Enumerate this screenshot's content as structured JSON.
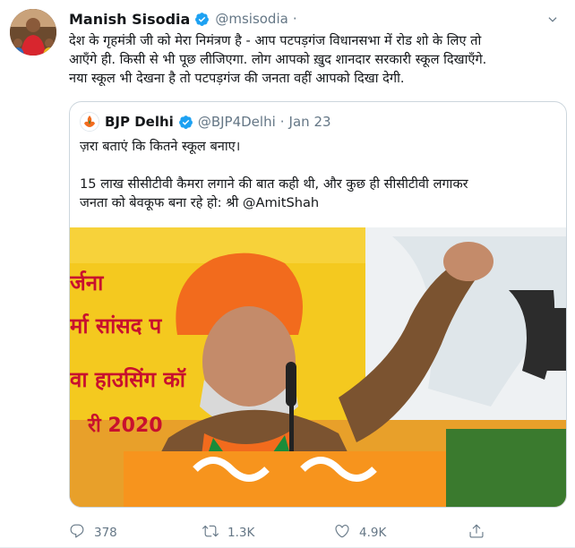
{
  "tweet": {
    "author_name": "Manish Sisodia",
    "author_handle": "@msisodia",
    "separator": "·",
    "text_lines": [
      "देश के गृहमंत्री जी को मेरा निमंत्रण है - आप पटपड़गंज विधानसभा में रोड शो के लिए तो",
      "आएँगे ही. किसी से भी पूछ लीजिएगा. लोग आपको ख़ुद शानदार सरकारी स्कूल दिखाएँगे.",
      "नया स्कूल भी देखना है तो पटपड़गंज की जनता वहीं आपको दिखा देगी."
    ]
  },
  "quote": {
    "author_name": "BJP Delhi",
    "author_handle": "@BJP4Delhi",
    "separator": "·",
    "date": "Jan 23",
    "text_lines": [
      "ज़रा बताएं कि कितने स्कूल बनाए।",
      "",
      "15 लाख सीसीटीवी कैमरा लगाने की बात कही थी, और कुछ ही सीसीटीवी लगाकर",
      "जनता को बेवकूफ बना रहे हो: श्री @AmitShah"
    ],
    "banner_lines": [
      "र्जना",
      "र्मा सांसद प",
      "वा हाउसिंग कॉ",
      "री 2020"
    ]
  },
  "actions": {
    "reply_count": "378",
    "retweet_count": "1.3K",
    "like_count": "4.9K"
  },
  "colors": {
    "text": "#14171a",
    "secondary": "#657786",
    "border": "#ccd6dd",
    "verified": "#1da1f2",
    "saffron": "#f26b1d"
  },
  "icons": [
    "verified-icon",
    "chevron-down-icon",
    "reply-icon",
    "retweet-icon",
    "like-icon",
    "share-icon"
  ]
}
